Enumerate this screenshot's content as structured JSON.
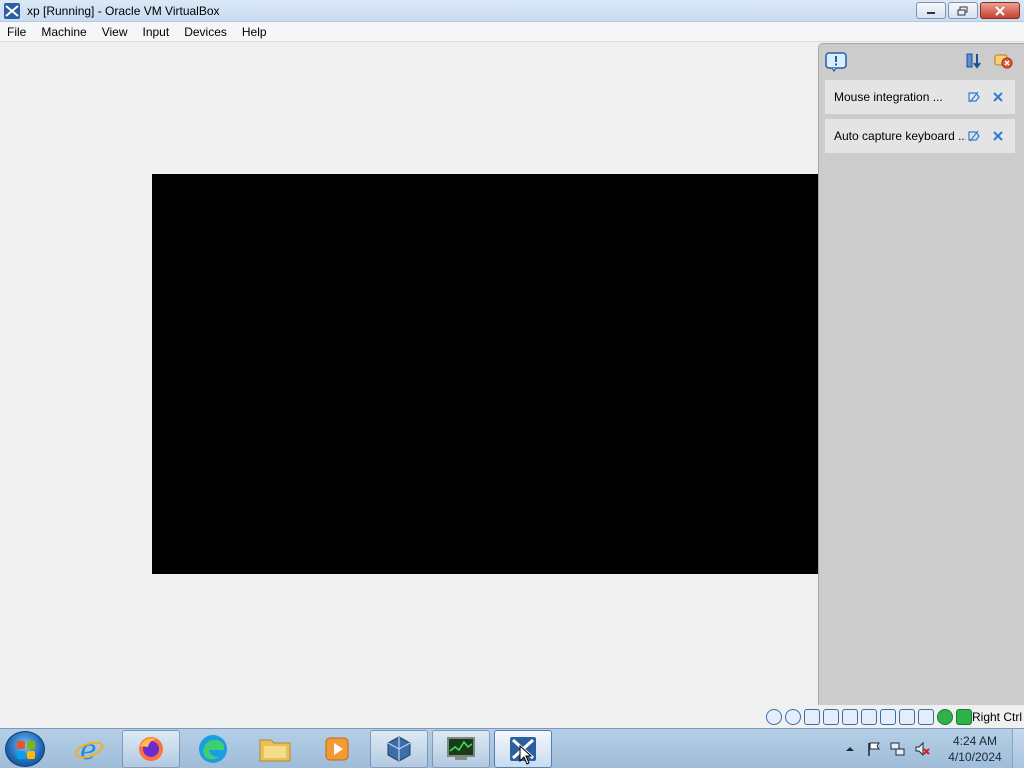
{
  "window": {
    "title": "xp [Running] - Oracle VM VirtualBox"
  },
  "menubar": {
    "items": [
      "File",
      "Machine",
      "View",
      "Input",
      "Devices",
      "Help"
    ]
  },
  "notifications": {
    "items": [
      {
        "label": "Mouse integration ..."
      },
      {
        "label": "Auto capture keyboard ..."
      }
    ]
  },
  "statusbar": {
    "host_key": "Right Ctrl",
    "icons": [
      "hard-disk-icon",
      "optical-drive-icon",
      "audio-icon",
      "network-icon",
      "usb-icon",
      "shared-folders-icon",
      "display-icon",
      "video-capture-icon",
      "cpu-icon",
      "mouse-integration-icon",
      "host-key-indicator-icon"
    ]
  },
  "taskbar": {
    "apps": [
      "internet-explorer",
      "firefox",
      "edge",
      "file-explorer",
      "media-player",
      "virtualbox",
      "task-manager",
      "virtualbox-vm"
    ],
    "clock": {
      "time": "4:24 AM",
      "date": "4/10/2024"
    }
  },
  "colors": {
    "vm_screen": "#000000",
    "titlebar": "#dbe8f6",
    "notify_panel": "#cccccc",
    "taskbar": "#b5cfe6"
  }
}
